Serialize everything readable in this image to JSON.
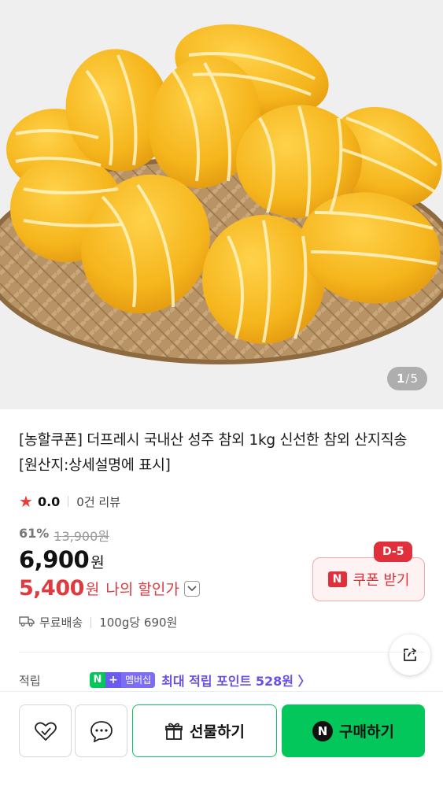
{
  "gallery": {
    "current": "1",
    "separator": "/",
    "total": "5"
  },
  "product": {
    "title": "[농할쿠폰] 더프레시 국내산 성주 참외 1kg 신선한 참외 산지직송 [원산지:상세설명에 표시]",
    "rating": "0.0",
    "reviews": "0건 리뷰"
  },
  "pricing": {
    "discount_rate": "61%",
    "original_price": "13,900원",
    "price": "6,900",
    "currency": "원",
    "my_price": "5,400",
    "my_price_label": "나의 할인가"
  },
  "coupon": {
    "dday": "D-5",
    "badge": "N",
    "label": "쿠폰 받기"
  },
  "delivery": {
    "label": "무료배송",
    "unit_price": "100g당 690원"
  },
  "points": {
    "label": "적립",
    "badge_n": "N",
    "badge_plus": "+",
    "badge_member": "멤버십",
    "text": "최대 적립 포인트 528원 〉"
  },
  "actions": {
    "gift_label": "선물하기",
    "buy_badge": "N",
    "buy_label": "구매하기"
  },
  "colors": {
    "accent_red": "#e0303b",
    "naver_green": "#03c75a",
    "membership_purple": "#6a4fe8"
  }
}
